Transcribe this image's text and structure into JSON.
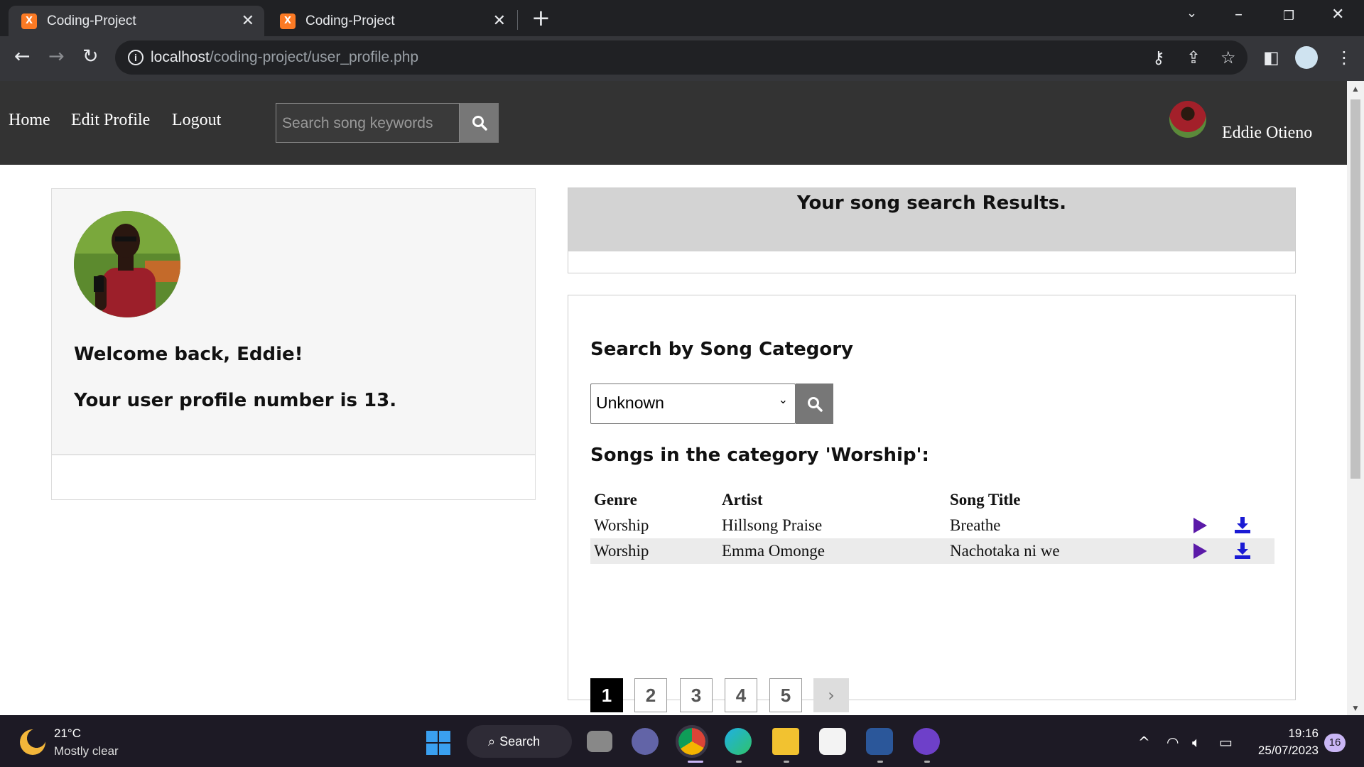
{
  "browser": {
    "tabs": [
      {
        "title": "Coding-Project",
        "active": true
      },
      {
        "title": "Coding-Project",
        "active": false
      }
    ],
    "url_host": "localhost",
    "url_path": "/coding-project/user_profile.php"
  },
  "nav": {
    "links": [
      "Home",
      "Edit Profile",
      "Logout"
    ],
    "search_placeholder": "Search song keywords",
    "user_name": "Eddie Otieno"
  },
  "profile": {
    "welcome": "Welcome back, Eddie!",
    "profile_number_text": "Your user profile number is 13."
  },
  "results": {
    "title": "Your song search Results."
  },
  "category": {
    "title": "Search by Song Category",
    "selected": "Unknown",
    "songs_heading": "Songs in the category 'Worship':",
    "columns": [
      "Genre",
      "Artist",
      "Song Title"
    ],
    "rows": [
      {
        "genre": "Worship",
        "artist": "Hillsong Praise",
        "title": "Breathe"
      },
      {
        "genre": "Worship",
        "artist": "Emma Omonge",
        "title": "Nachotaka ni we"
      }
    ],
    "pages": [
      "1",
      "2",
      "3",
      "4",
      "5"
    ],
    "current_page": "1",
    "next_label": "›"
  },
  "taskbar": {
    "temperature": "21°C",
    "condition": "Mostly clear",
    "search_label": "Search",
    "time": "19:16",
    "date": "25/07/2023",
    "notification_count": "16"
  },
  "colors": {
    "nav_bg": "#333333",
    "play": "#5b1aa8",
    "download": "#1a1ad4",
    "tab_favicon": "#fb7a24"
  }
}
